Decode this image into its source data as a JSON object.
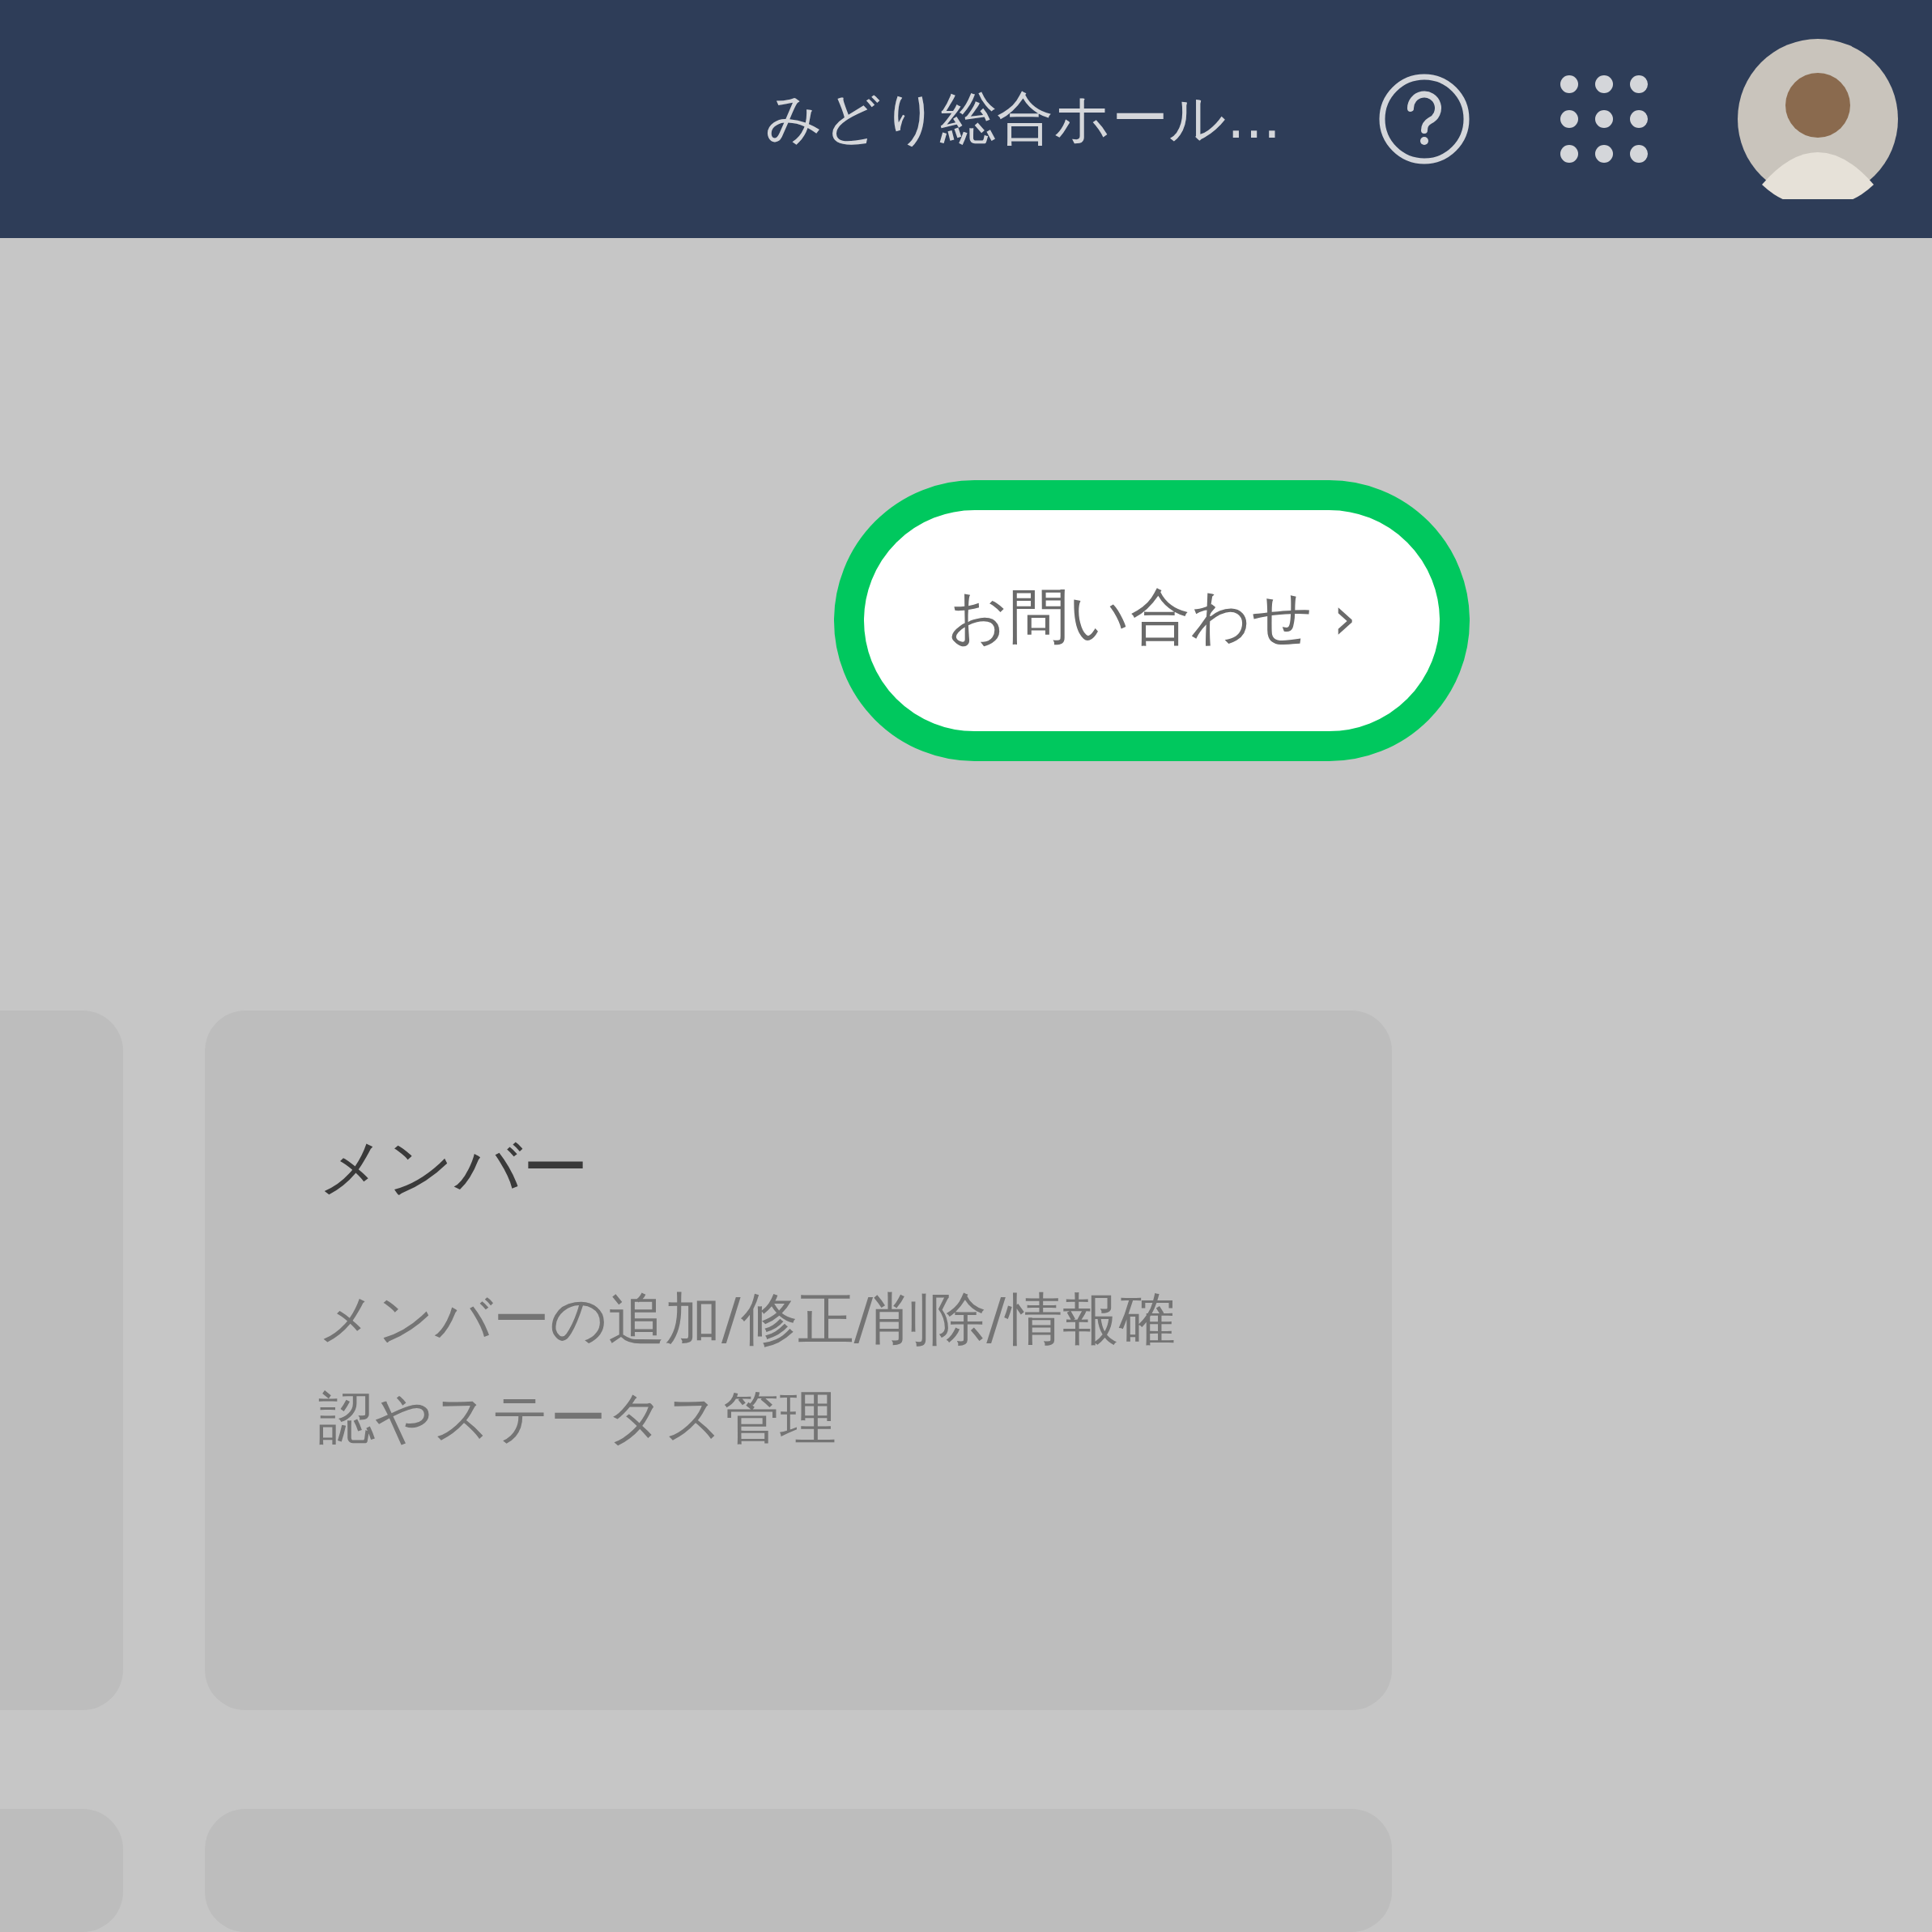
{
  "header": {
    "title": "みどり総合ホール..."
  },
  "contact_button": {
    "label": "お問い合わせ",
    "chevron": "›"
  },
  "cards": [
    {
      "kind": "partial"
    },
    {
      "kind": "full",
      "title": "メンバー",
      "description": "メンバーの追加/修正/削除/情報確認やステータス管理"
    }
  ],
  "lower_cards": [
    {
      "kind": "partial"
    },
    {
      "kind": "full"
    }
  ]
}
